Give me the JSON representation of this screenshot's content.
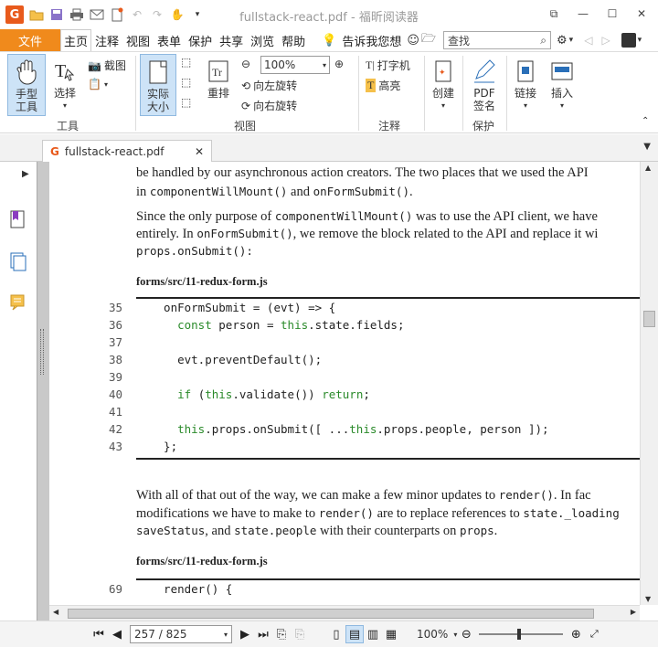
{
  "window": {
    "title": "fullstack-react.pdf - 福昕阅读器",
    "app_logo": "G"
  },
  "menu": {
    "file": "文件",
    "items": [
      "主页",
      "注释",
      "视图",
      "表单",
      "保护",
      "共享",
      "浏览",
      "帮助"
    ],
    "tell_me": "告诉我您想",
    "search_placeholder": "查找"
  },
  "ribbon": {
    "hand_tool": "手型\n工具",
    "select": "选择",
    "snapshot": "截图",
    "group_tools": "工具",
    "actual_size": "实际\n大小",
    "reflow": "重排",
    "zoom_value": "100%",
    "rotate_left": "向左旋转",
    "rotate_right": "向右旋转",
    "group_view": "视图",
    "typewriter": "打字机",
    "highlight": "高亮",
    "group_comment": "注释",
    "create": "创建",
    "pdf_sign": "PDF\n签名",
    "group_protect": "保护",
    "link": "链接",
    "insert": "插入"
  },
  "tab": {
    "label": "fullstack-react.pdf"
  },
  "document": {
    "p1_a": "be handled by our asynchronous action creators. The two places that we used the API",
    "p1_b_pre": "in ",
    "p1_b_code1": "componentWillMount()",
    "p1_b_mid": " and ",
    "p1_b_code2": "onFormSubmit()",
    "p1_b_end": ".",
    "p2_a_pre": "Since the only purpose of ",
    "p2_a_code": "componentWillMount()",
    "p2_a_end": " was to use the API client, we have",
    "p2_b_pre": "entirely. In ",
    "p2_b_code": "onFormSubmit()",
    "p2_b_end": ", we remove the block related to the API and replace it wi",
    "p2_c_code": "props.onSubmit():",
    "file1": "forms/src/11-redux-form.js",
    "code1": [
      {
        "n": "35",
        "pre": "  onFormSubmit = (evt) => {",
        "kw": "",
        "post": ""
      },
      {
        "n": "36",
        "pre": "    ",
        "kw": "const",
        "post": " person = ",
        "kw2": "this",
        "post2": ".state.fields;"
      },
      {
        "n": "37",
        "pre": "",
        "kw": "",
        "post": ""
      },
      {
        "n": "38",
        "pre": "    evt.preventDefault();",
        "kw": "",
        "post": ""
      },
      {
        "n": "39",
        "pre": "",
        "kw": "",
        "post": ""
      },
      {
        "n": "40",
        "pre": "    ",
        "kw": "if",
        "post": " (",
        "kw2": "this",
        "post2": ".validate()) ",
        "kw3": "return",
        "post3": ";"
      },
      {
        "n": "41",
        "pre": "",
        "kw": "",
        "post": ""
      },
      {
        "n": "42",
        "pre": "    ",
        "kw": "this",
        "post": ".props.onSubmit([ ...",
        "kw2": "this",
        "post2": ".props.people, person ]);"
      },
      {
        "n": "43",
        "pre": "  };",
        "kw": "",
        "post": ""
      }
    ],
    "p3_a_pre": "With all of that out of the way, we can make a few minor updates to ",
    "p3_a_code": "render()",
    "p3_a_end": ". In fac",
    "p3_b_pre": "modifications we have to make to ",
    "p3_b_code": "render()",
    "p3_b_mid": " are to replace references to ",
    "p3_b_code2": "state._loading",
    "p3_c_code1": "saveStatus",
    "p3_c_mid": ", and ",
    "p3_c_code2": "state.people",
    "p3_c_mid2": " with their counterparts on ",
    "p3_c_code3": "props",
    "p3_c_end": ".",
    "file2": "forms/src/11-redux-form.js",
    "code2_n": "69",
    "code2_text": "  render() {"
  },
  "status": {
    "page": "257 / 825",
    "zoom": "100%"
  }
}
